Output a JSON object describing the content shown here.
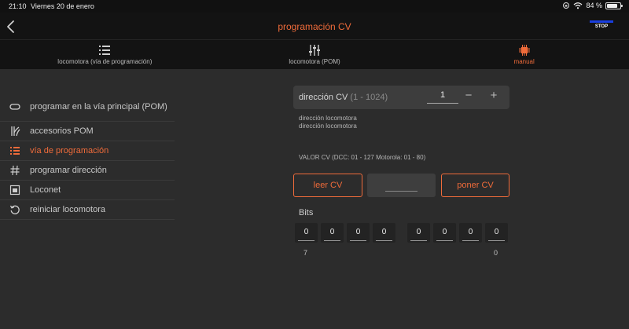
{
  "status": {
    "time": "21:10",
    "date": "Viernes 20 de enero",
    "battery": "84 %",
    "battery_level": 0.84
  },
  "header": {
    "title": "programación CV",
    "stop_label": "STOP"
  },
  "tabs": [
    {
      "label": "locomotora (vía de programación)",
      "icon": "list-icon"
    },
    {
      "label": "locomotora (POM)",
      "icon": "sliders-icon"
    },
    {
      "label": "manual",
      "icon": "chip-icon",
      "active": true
    }
  ],
  "sidebar": {
    "items": [
      {
        "label": "programar en la vía principal (POM)",
        "icon": "track-loop-icon"
      },
      {
        "label": "accesorios POM",
        "icon": "turnout-icon"
      },
      {
        "label": "vía de programación",
        "icon": "list-icon",
        "active": true
      },
      {
        "label": "programar dirección",
        "icon": "hash-icon"
      },
      {
        "label": "Loconet",
        "icon": "loconet-icon"
      },
      {
        "label": "reiniciar locomotora",
        "icon": "reset-icon"
      }
    ]
  },
  "main": {
    "address": {
      "label": "dirección CV",
      "range": "(1 - 1024)",
      "value": "1"
    },
    "notes": [
      "dirección locomotora",
      "dirección locomotora"
    ],
    "cv_range_text": "VALOR CV (DCC: 01 - 127 Motorola: 01 -  80)",
    "read_button": "leer CV",
    "write_button": "poner CV",
    "cv_value": "",
    "bits_label": "Bits",
    "bits": [
      "0",
      "0",
      "0",
      "0",
      "0",
      "0",
      "0",
      "0"
    ],
    "bit_high_index": "7",
    "bit_low_index": "0"
  },
  "colors": {
    "accent": "#ef6b3a",
    "background": "#2c2c2c",
    "header": "#131313",
    "stop": "#1a3fe0"
  }
}
